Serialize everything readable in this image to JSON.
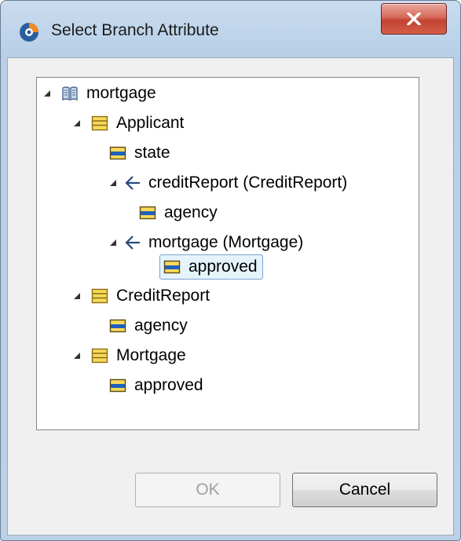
{
  "window": {
    "title": "Select Branch Attribute"
  },
  "tree": {
    "root": {
      "label": "mortgage",
      "icon": "book-icon"
    },
    "nodes": [
      {
        "label": "Applicant",
        "icon": "class-icon"
      },
      {
        "label": "state",
        "icon": "attribute-icon"
      },
      {
        "label": "creditReport (CreditReport)",
        "icon": "reference-icon"
      },
      {
        "label": "agency",
        "icon": "attribute-icon"
      },
      {
        "label": "mortgage (Mortgage)",
        "icon": "reference-icon"
      },
      {
        "label": "approved",
        "icon": "attribute-icon",
        "selected": true
      },
      {
        "label": "CreditReport",
        "icon": "class-icon"
      },
      {
        "label": "agency",
        "icon": "attribute-icon"
      },
      {
        "label": "Mortgage",
        "icon": "class-icon"
      },
      {
        "label": "approved",
        "icon": "attribute-icon"
      }
    ]
  },
  "buttons": {
    "ok": "OK",
    "cancel": "Cancel"
  },
  "colors": {
    "selection": "#e5f3fb",
    "selection_border": "#7da2ce",
    "close": "#c24333"
  }
}
